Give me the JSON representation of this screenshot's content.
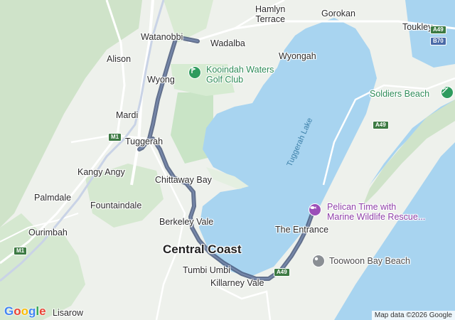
{
  "map": {
    "place_labels": {
      "hamlyn_terrace": "Hamlyn\nTerrace",
      "gorokan": "Gorokan",
      "toukley": "Toukley",
      "watanobbi": "Watanobbi",
      "wadalba": "Wadalba",
      "alison": "Alison",
      "wyongah": "Wyongah",
      "wyong": "Wyong",
      "mardi": "Mardi",
      "tuggerah": "Tuggerah",
      "kangy_angy": "Kangy Angy",
      "chittaway_bay": "Chittaway Bay",
      "palmdale": "Palmdale",
      "fountaindale": "Fountaindale",
      "berkeley_vale": "Berkeley Vale",
      "ourimbah": "Ourimbah",
      "central_coast": "Central Coast",
      "the_entrance": "The Entrance",
      "tumbi_umbi": "Tumbi Umbi",
      "killarney_vale": "Killarney Vale",
      "lisarow": "Lisarow"
    },
    "poi_labels": {
      "kooindah_waters": "Kooindah Waters\nGolf Club",
      "soldiers_beach": "Soldiers Beach",
      "pelican_time": "Pelican Time with\nMarine Wildlife Rescue...",
      "toowoon_bay_beach": "Toowoon Bay Beach"
    },
    "water_labels": {
      "tuggerah_lake": "Tuggerah Lake"
    },
    "road_shields": {
      "a49_top": "A49",
      "b70": "B70",
      "a49_mid": "A49",
      "m1_north": "M1",
      "m1_south": "M1",
      "a49_south": "A49"
    },
    "icons": {
      "golf": "golf-icon",
      "beach": "beach-icon",
      "aquarium": "aquarium-icon",
      "pin": "location-pin-icon"
    },
    "colors": {
      "water": "#a8d4f0",
      "land": "#eef1ec",
      "park": "#cfe7cf",
      "route": "#4a5a7d",
      "golf_poi": "#2e9b5e",
      "attraction_poi": "#9b4fb8",
      "beach_poi": "#8a8f94"
    }
  },
  "footer": {
    "logo": "Google",
    "attribution": "Map data ©2026 Google"
  }
}
